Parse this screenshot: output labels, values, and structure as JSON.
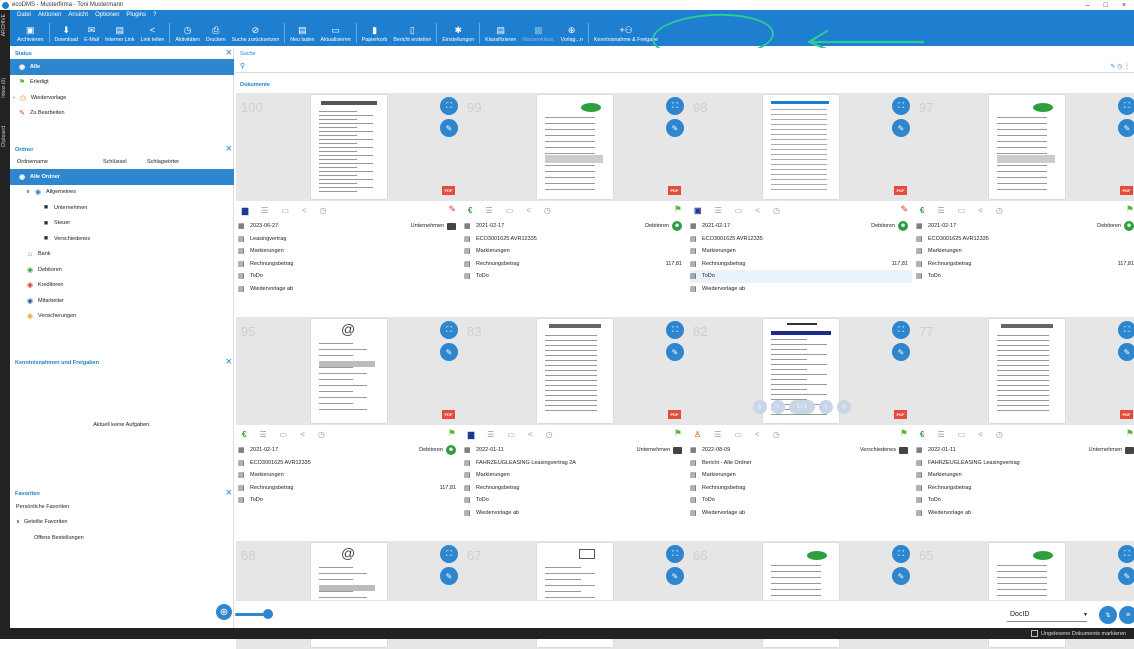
{
  "window": {
    "title": "ecoDMS - Musterfirma - Toni Mustermann",
    "controls": [
      "–",
      "□",
      "×"
    ]
  },
  "sidestrip": [
    "ARCHIVE",
    "Inbox (0)",
    "Clipboard"
  ],
  "menu": [
    "Datei",
    "Aktionen",
    "Ansicht",
    "Optionen",
    "Plugins",
    "?"
  ],
  "toolbar": [
    {
      "label": "Archivieren",
      "icon": "▣"
    },
    {
      "sep": true
    },
    {
      "label": "Download",
      "icon": "⬇"
    },
    {
      "label": "E-Mail",
      "icon": "✉"
    },
    {
      "label": "Interner Link",
      "icon": "▤"
    },
    {
      "label": "Link teilen",
      "icon": "<"
    },
    {
      "sep": true
    },
    {
      "label": "Aktivitäten",
      "icon": "◷"
    },
    {
      "label": "Drucken",
      "icon": "⎙"
    },
    {
      "label": "Suche zurücksetzen",
      "icon": "⊘"
    },
    {
      "sep": true
    },
    {
      "label": "Neu laden",
      "icon": "▤"
    },
    {
      "label": "Aktualisieren",
      "icon": "▭"
    },
    {
      "sep": true
    },
    {
      "label": "Papierkorb",
      "icon": "▮"
    },
    {
      "label": "Bericht erstellen",
      "icon": "▯"
    },
    {
      "sep": true
    },
    {
      "label": "Einstellungen",
      "icon": "✱"
    },
    {
      "sep": true
    },
    {
      "label": "Klassifizieren",
      "icon": "▤"
    },
    {
      "label": "Massenklass.",
      "icon": "▩",
      "disabled": true
    },
    {
      "label": "Vorlag...n",
      "icon": "⊕"
    },
    {
      "sep": true
    },
    {
      "label": "Kenntnisnahme & Freigabe",
      "icon": "+⚇"
    }
  ],
  "status": {
    "title": "Status",
    "items": [
      {
        "label": "Alle",
        "icon": "◉",
        "selected": true
      },
      {
        "label": "Erledigt",
        "icon": "⚑"
      },
      {
        "label": "Wiedervorlage",
        "icon": "◷",
        "expand": "›"
      },
      {
        "label": "Zu Bearbeiten",
        "icon": "✎"
      }
    ]
  },
  "ordner": {
    "title": "Ordner",
    "cols": [
      "Ordnername",
      "Schlüssel",
      "Schlagwörter"
    ],
    "items": [
      {
        "label": "Alle Ordner",
        "icon": "◉",
        "selected": true,
        "indent": 0
      },
      {
        "label": "Allgemeines",
        "icon": "◉",
        "indent": 1,
        "expand": "∨"
      },
      {
        "label": "Unternehmen",
        "icon": "■",
        "indent": 3
      },
      {
        "label": "Steuer",
        "icon": "■",
        "indent": 3
      },
      {
        "label": "Verschiedenes",
        "icon": "■",
        "indent": 3
      },
      {
        "label": "Bank",
        "icon": "⌂",
        "indent": 1
      },
      {
        "label": "Debitoren",
        "icon": "◉",
        "indent": 1
      },
      {
        "label": "Kreditoren",
        "icon": "◉",
        "indent": 1
      },
      {
        "label": "Mitarbeiter",
        "icon": "◉",
        "indent": 1
      },
      {
        "label": "Versicherungen",
        "icon": "◉",
        "indent": 1
      }
    ]
  },
  "kenntnis": {
    "title": "Kenntnisnahmen und Freigaben",
    "empty": "Aktuell keine Aufgaben."
  },
  "favoriten": {
    "title": "Favoriten",
    "items": [
      "Persönliche Favoriten",
      "Geteilte Favoriten",
      "Offene Bestellungen"
    ],
    "expand": "∨"
  },
  "search": {
    "label": "Suche",
    "icon": "⚲",
    "right": "✎ ◷ ⋮"
  },
  "documents_label": "Dokumente",
  "cards": [
    {
      "num": "100",
      "kind": "leasing",
      "type_icon": "▆",
      "flag": "✎",
      "flag_color": "#d33",
      "date": "2023-06-27",
      "folder": "Unternehmen",
      "badge": "",
      "title": "Leasingvertrag",
      "rows": [
        "Markierungen",
        "Rechnungsbetrag",
        "ToDo",
        "Wiedervorlage ab"
      ],
      "amount": ""
    },
    {
      "num": "99",
      "kind": "eco",
      "type_icon": "€",
      "flag": "⚑",
      "flag_color": "#5cb82e",
      "date": "2021-02-17",
      "folder": "Debitoren",
      "badge": "☻",
      "title": "ECO3001625 AVR12335",
      "rows": [
        "Markierungen",
        "Rechnungsbetrag",
        "ToDo"
      ],
      "amount": "117,81"
    },
    {
      "num": "98",
      "kind": "table",
      "type_icon": "▣",
      "flag": "✎",
      "flag_color": "#d33",
      "date": "2021-02-17",
      "folder": "Debitoren",
      "badge": "☻",
      "title": "ECO3001625 AVR12335",
      "rows": [
        "Markierungen",
        "Rechnungsbetrag",
        "ToDo",
        "Wiedervorlage ab"
      ],
      "amount": "117,81"
    },
    {
      "num": "97",
      "kind": "eco",
      "type_icon": "€",
      "flag": "⚑",
      "flag_color": "#5cb82e",
      "date": "2021-02-17",
      "folder": "Debitoren",
      "badge": "☻",
      "title": "ECO3001625 AVR12335",
      "rows": [
        "Markierungen",
        "Rechnungsbetrag",
        "ToDo"
      ],
      "amount": "117,81"
    },
    {
      "num": "95",
      "kind": "at",
      "type_icon": "€",
      "flag": "⚑",
      "flag_color": "#5cb82e",
      "date": "2021-02-17",
      "folder": "Debitoren",
      "badge": "☻",
      "title": "ECO3001625 AVR12335",
      "rows": [
        "Markierungen",
        "Rechnungsbetrag",
        "ToDo"
      ],
      "amount": "117,81"
    },
    {
      "num": "83",
      "kind": "auto",
      "type_icon": "▆",
      "flag": "⚑",
      "flag_color": "#5cb82e",
      "date": "2022-01-11",
      "folder": "Unternehmen",
      "badge": "",
      "title": "FAHRZEUGLEASING Leasingvertrag 2A",
      "rows": [
        "Markierungen",
        "Rechnungsbetrag",
        "ToDo",
        "Wiedervorlage ab"
      ],
      "amount": ""
    },
    {
      "num": "82",
      "kind": "report",
      "type_icon": "♙",
      "flag": "⚑",
      "flag_color": "#5cb82e",
      "date": "2022-08-09",
      "folder": "Verschiedenes",
      "badge": "",
      "title": "Bericht - Alle Ordner",
      "rows": [
        "Markierungen",
        "Rechnungsbetrag",
        "ToDo",
        "Wiedervorlage ab"
      ],
      "amount": ""
    },
    {
      "num": "77",
      "kind": "auto",
      "type_icon": "€",
      "flag": "⚑",
      "flag_color": "#5cb82e",
      "date": "2022-01-11",
      "folder": "Unternehmen",
      "badge": "",
      "title": "FAHRZEUGLEASING Leasingvertrag",
      "rows": [
        "Markierungen",
        "Rechnungsbetrag",
        "ToDo",
        "Wiedervorlage ab"
      ],
      "amount": ""
    },
    {
      "num": "68",
      "kind": "at",
      "partial": true
    },
    {
      "num": "67",
      "kind": "sketch",
      "partial": true
    },
    {
      "num": "66",
      "kind": "eco",
      "partial": true
    },
    {
      "num": "65",
      "kind": "eco",
      "partial": true
    }
  ],
  "viewer": {
    "page": "1 / 1"
  },
  "sort": {
    "value": "DocID",
    "arrow": "▾"
  },
  "status_text": "Ungelesene Dokumente markieren",
  "colors": {
    "accent": "#1e7fd0",
    "selected": "#2e86cf",
    "annotation": "#2ec79a",
    "pdf": "#e84a3c"
  }
}
